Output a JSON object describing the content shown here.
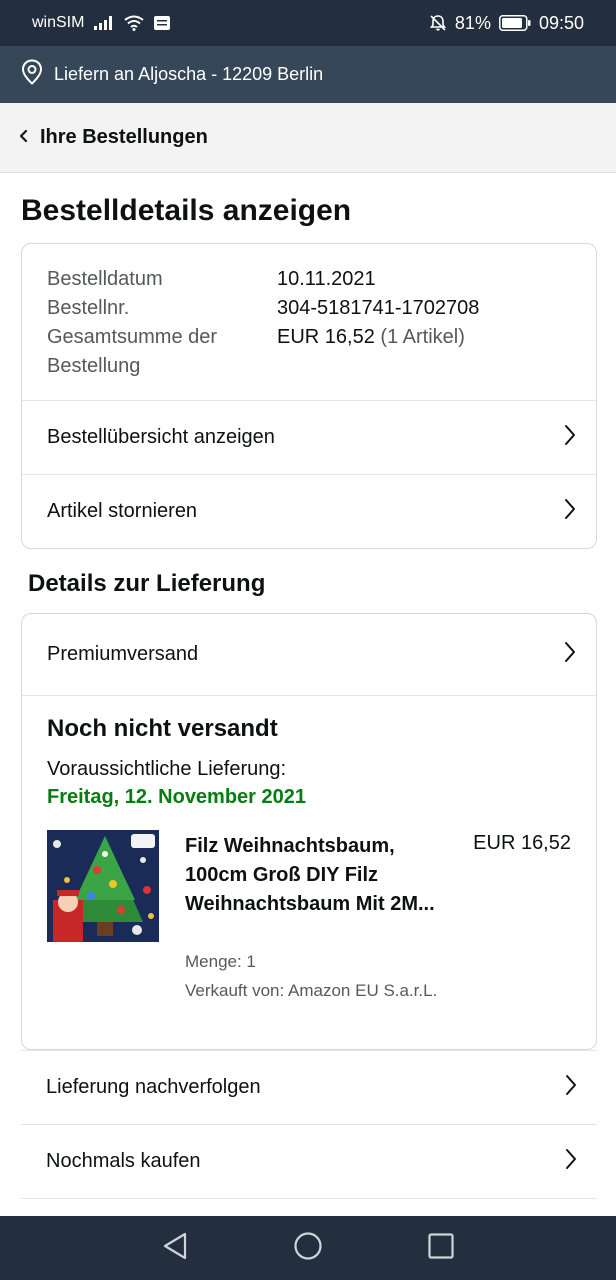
{
  "status_bar": {
    "carrier": "winSIM",
    "battery": "81%",
    "time": "09:50"
  },
  "delivery_bar": {
    "text": "Liefern an Aljoscha - 12209 Berlin"
  },
  "back_nav": {
    "label": "Ihre Bestellungen"
  },
  "page_title": "Bestelldetails anzeigen",
  "order_summary": {
    "date_label": "Bestelldatum",
    "date_value": "10.11.2021",
    "number_label": "Bestellnr.",
    "number_value": "304-5181741-1702708",
    "total_label": "Gesamtsumme der Bestellung",
    "total_value": "EUR 16,52",
    "total_items": "(1 Artikel)"
  },
  "order_links": {
    "overview": "Bestellübersicht anzeigen",
    "cancel": "Artikel stornieren"
  },
  "delivery_section": {
    "title": "Details zur Lieferung",
    "shipping_method": "Premiumversand",
    "status": "Noch nicht versandt",
    "expected_label": "Voraussichtliche Lieferung:",
    "expected_date": "Freitag, 12. November 2021"
  },
  "product": {
    "title": "Filz Weihnachtsbaum, 100cm Groß DIY Filz Weihnachtsbaum Mit 2M...",
    "price": "EUR 16,52",
    "quantity": "Menge: 1",
    "seller": "Verkauft von: Amazon EU S.a.r.L."
  },
  "more_links": {
    "track": "Lieferung nachverfolgen",
    "buy_again": "Nochmals kaufen"
  },
  "colors": {
    "status_bar_bg": "#232f3e",
    "delivery_bar_bg": "#37475a",
    "date_green": "#067d12"
  },
  "icons": {
    "location": "location-pin-icon",
    "back": "chevron-left-icon",
    "row": "chevron-right-icon",
    "nav_back": "nav-back-icon",
    "nav_home": "nav-home-icon",
    "nav_recents": "nav-recents-icon"
  }
}
